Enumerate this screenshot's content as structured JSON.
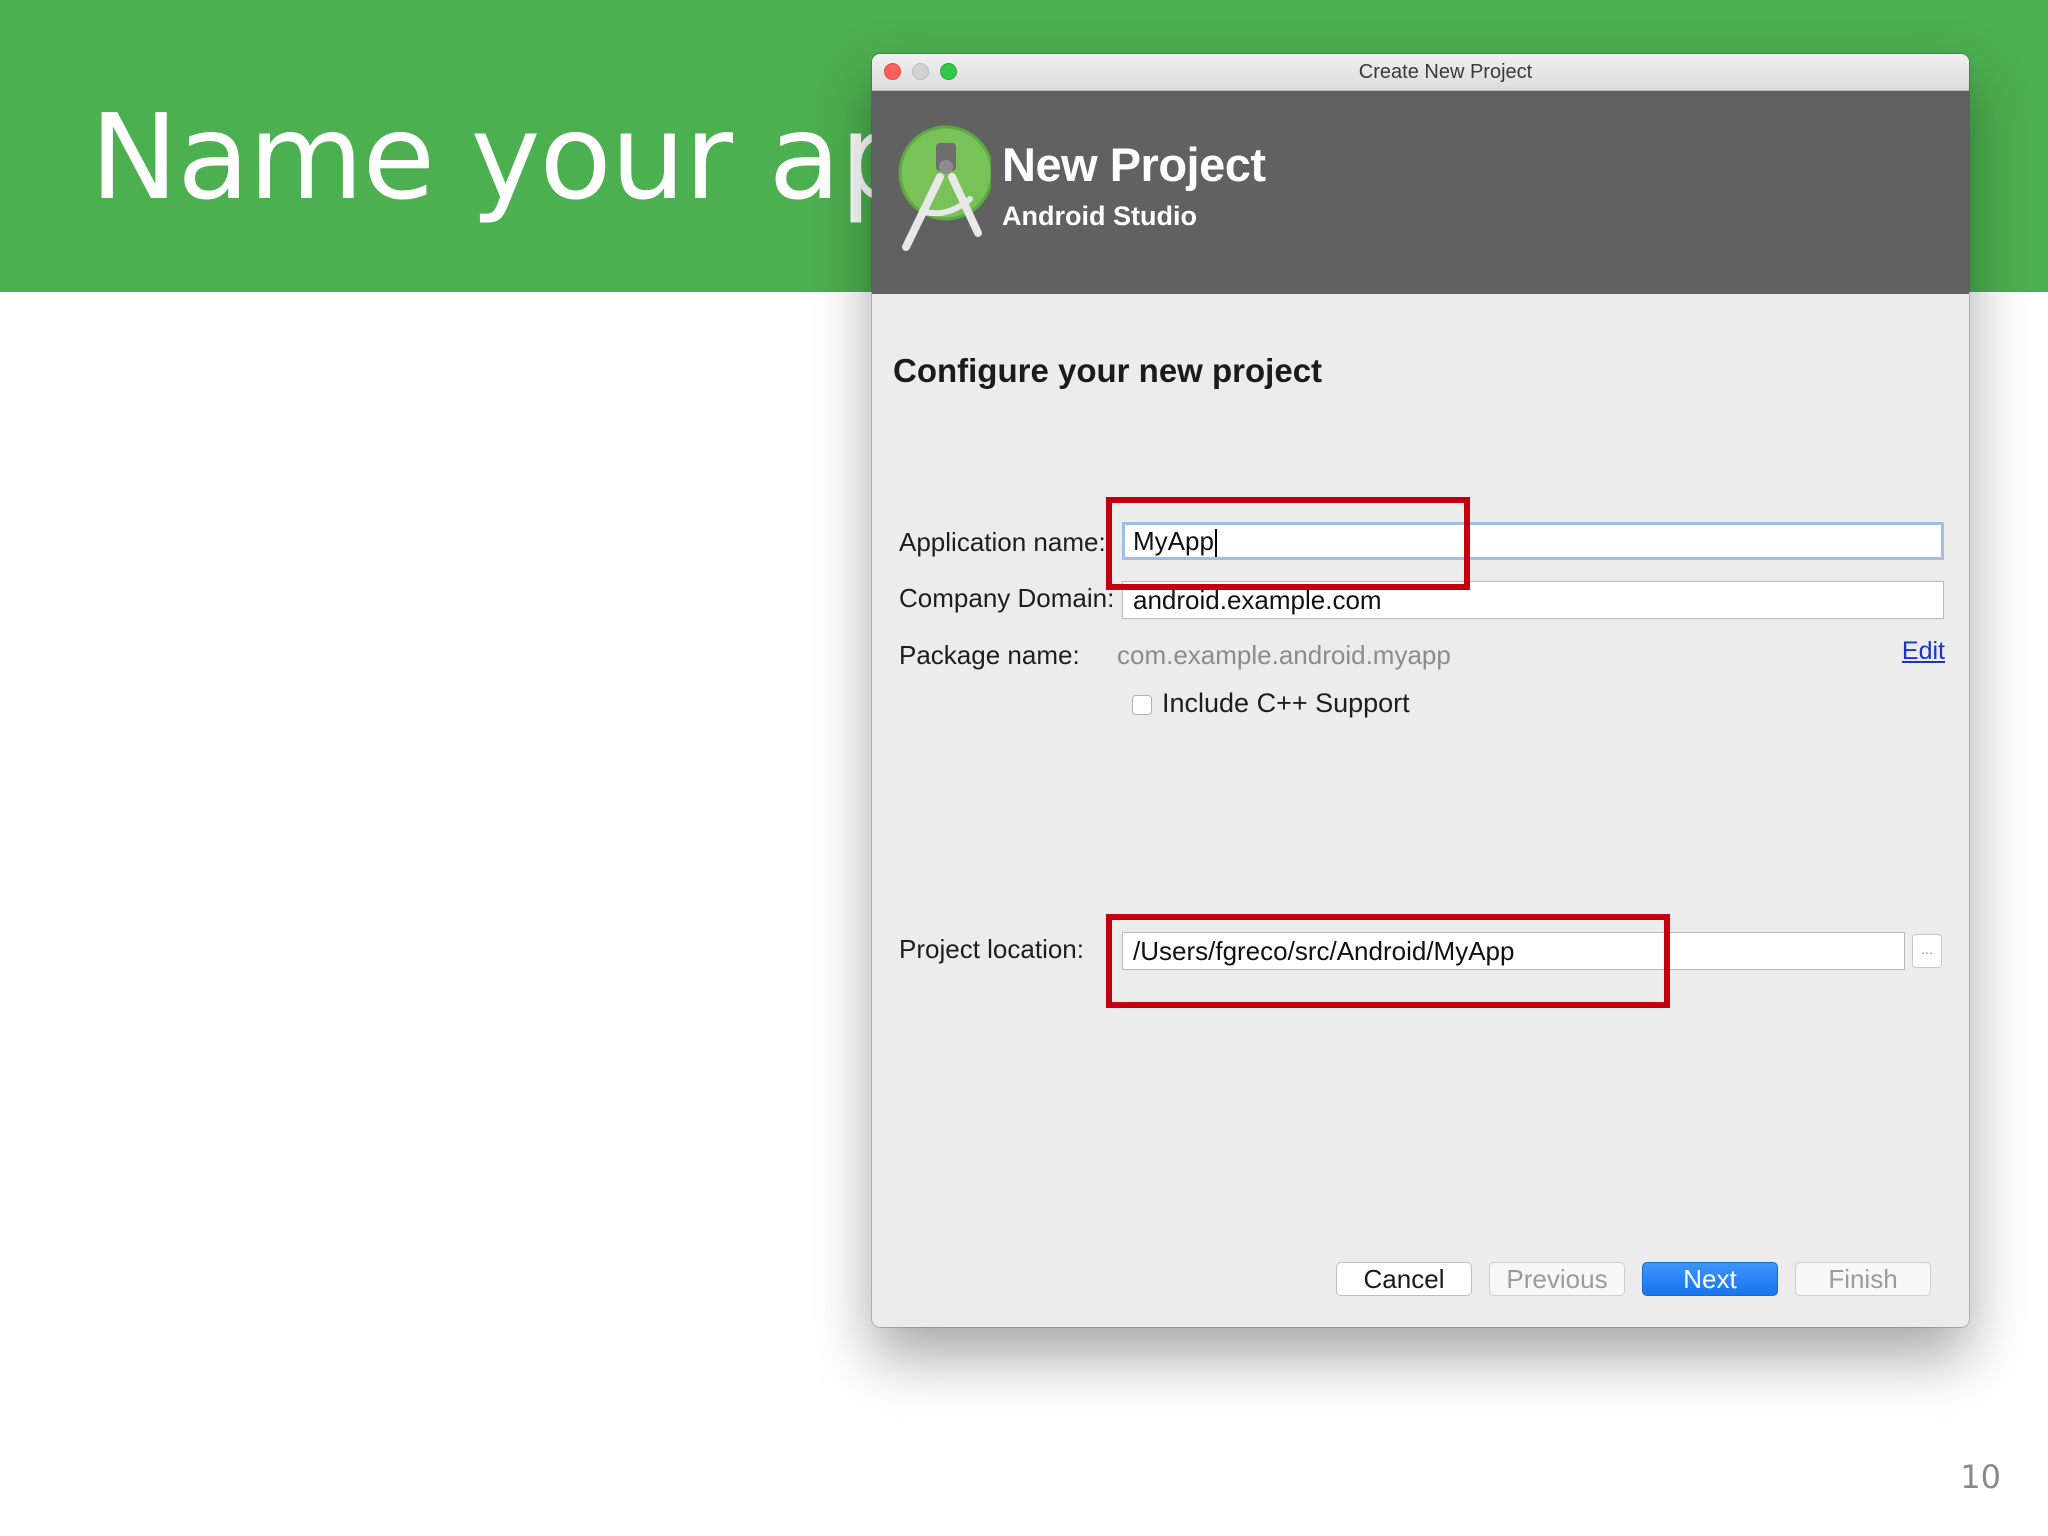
{
  "slide": {
    "title": "Name your app",
    "page_number": "10"
  },
  "colors": {
    "banner": "#4caf50",
    "dialog_header": "#616161",
    "highlight": "#c3000f",
    "primary_button": "#1874ee",
    "link": "#1a35c4"
  },
  "window": {
    "title": "Create New Project"
  },
  "header": {
    "title": "New Project",
    "subtitle": "Android Studio",
    "logo_icon": "android-studio-logo-icon"
  },
  "form": {
    "heading": "Configure your new project",
    "application_name": {
      "label": "Application name:",
      "value": "MyApp"
    },
    "company_domain": {
      "label": "Company Domain:",
      "value": "android.example.com"
    },
    "package_name": {
      "label": "Package name:",
      "value": "com.example.android.myapp",
      "edit_label": "Edit"
    },
    "cpp_support": {
      "label": "Include C++ Support",
      "checked": false
    },
    "project_location": {
      "label": "Project location:",
      "value": "/Users/fgreco/src/Android/MyApp",
      "browse_label": "..."
    }
  },
  "buttons": {
    "cancel": "Cancel",
    "previous": "Previous",
    "next": "Next",
    "finish": "Finish"
  }
}
